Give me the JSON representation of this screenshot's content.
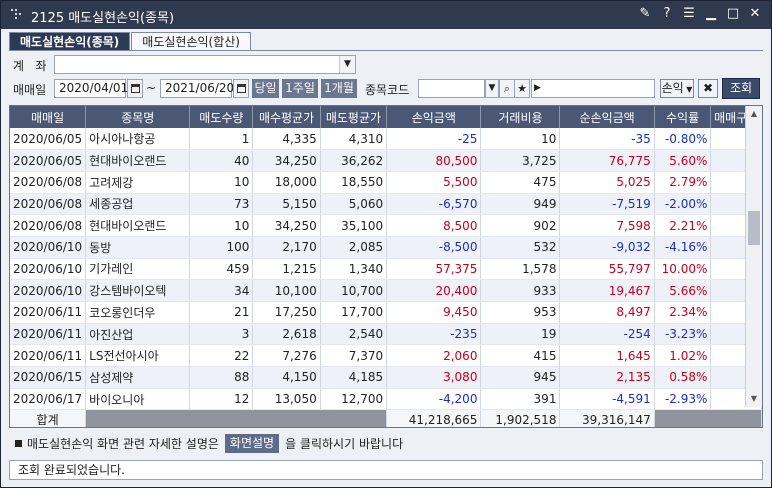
{
  "window": {
    "title": "2125 매도실현손익(종목)",
    "icons": [
      "pin-icon",
      "help-icon",
      "menu-icon",
      "minimize-icon",
      "maximize-icon",
      "close-icon"
    ]
  },
  "tabs": [
    {
      "label": "매도실현손익(종목)",
      "active": true
    },
    {
      "label": "매도실현손익(합산)",
      "active": false
    }
  ],
  "filters": {
    "account_label": "계   좌",
    "account_value": "",
    "period_label": "매매일",
    "from_date": "2020/04/01",
    "to_date": "2021/06/20",
    "tilde": "~",
    "today_label": "당일",
    "week_label": "1주일",
    "month_label": "1개월",
    "code_label": "종목코드",
    "code_value": "",
    "profit_label": "손익",
    "query_label": "조회"
  },
  "table": {
    "columns": [
      "매매일",
      "종목명",
      "매도수량",
      "매수평균가",
      "매도평균가",
      "손익금액",
      "거래비용",
      "순손익금액",
      "수익률",
      "매매구분"
    ],
    "rows": [
      [
        "2020/06/05",
        "아시아나항공",
        "1",
        "4,335",
        "4,310",
        "-25",
        "10",
        "-35",
        "-0.80%",
        ""
      ],
      [
        "2020/06/05",
        "현대바이오랜드",
        "40",
        "34,250",
        "36,262",
        "80,500",
        "3,725",
        "76,775",
        "5.60%",
        ""
      ],
      [
        "2020/06/08",
        "고려제강",
        "10",
        "18,000",
        "18,550",
        "5,500",
        "475",
        "5,025",
        "2.79%",
        ""
      ],
      [
        "2020/06/08",
        "세종공업",
        "73",
        "5,150",
        "5,060",
        "-6,570",
        "949",
        "-7,519",
        "-2.00%",
        ""
      ],
      [
        "2020/06/08",
        "현대바이오랜드",
        "10",
        "34,250",
        "35,100",
        "8,500",
        "902",
        "7,598",
        "2.21%",
        ""
      ],
      [
        "2020/06/10",
        "동방",
        "100",
        "2,170",
        "2,085",
        "-8,500",
        "532",
        "-9,032",
        "-4.16%",
        ""
      ],
      [
        "2020/06/10",
        "기가레인",
        "459",
        "1,215",
        "1,340",
        "57,375",
        "1,578",
        "55,797",
        "10.00%",
        ""
      ],
      [
        "2020/06/10",
        "강스템바이오텍",
        "34",
        "10,100",
        "10,700",
        "20,400",
        "933",
        "19,467",
        "5.66%",
        ""
      ],
      [
        "2020/06/11",
        "코오롱인더우",
        "21",
        "17,250",
        "17,700",
        "9,450",
        "953",
        "8,497",
        "2.34%",
        ""
      ],
      [
        "2020/06/11",
        "아진산업",
        "3",
        "2,618",
        "2,540",
        "-235",
        "19",
        "-254",
        "-3.23%",
        ""
      ],
      [
        "2020/06/11",
        "LS전선아시아",
        "22",
        "7,276",
        "7,370",
        "2,060",
        "415",
        "1,645",
        "1.02%",
        ""
      ],
      [
        "2020/06/15",
        "삼성제약",
        "88",
        "4,150",
        "4,185",
        "3,080",
        "945",
        "2,135",
        "0.58%",
        ""
      ],
      [
        "2020/06/17",
        "바이오니아",
        "12",
        "13,050",
        "12,700",
        "-4,200",
        "391",
        "-4,591",
        "-2.93%",
        ""
      ]
    ],
    "total": {
      "label": "합계",
      "profit": "41,218,665",
      "cost": "1,902,518",
      "net": "39,316,147"
    }
  },
  "info": {
    "text_before": "매도실현손익 화면 관련 자세한 설명은",
    "button": "화면설명",
    "text_after": "을 클릭하시기 바랍니다"
  },
  "status": "조회 완료되었습니다.",
  "colors": {
    "positive": "#c3001c",
    "negative": "#1a2ec4",
    "header": "#4b5875",
    "title_bar": "#303a4f"
  }
}
